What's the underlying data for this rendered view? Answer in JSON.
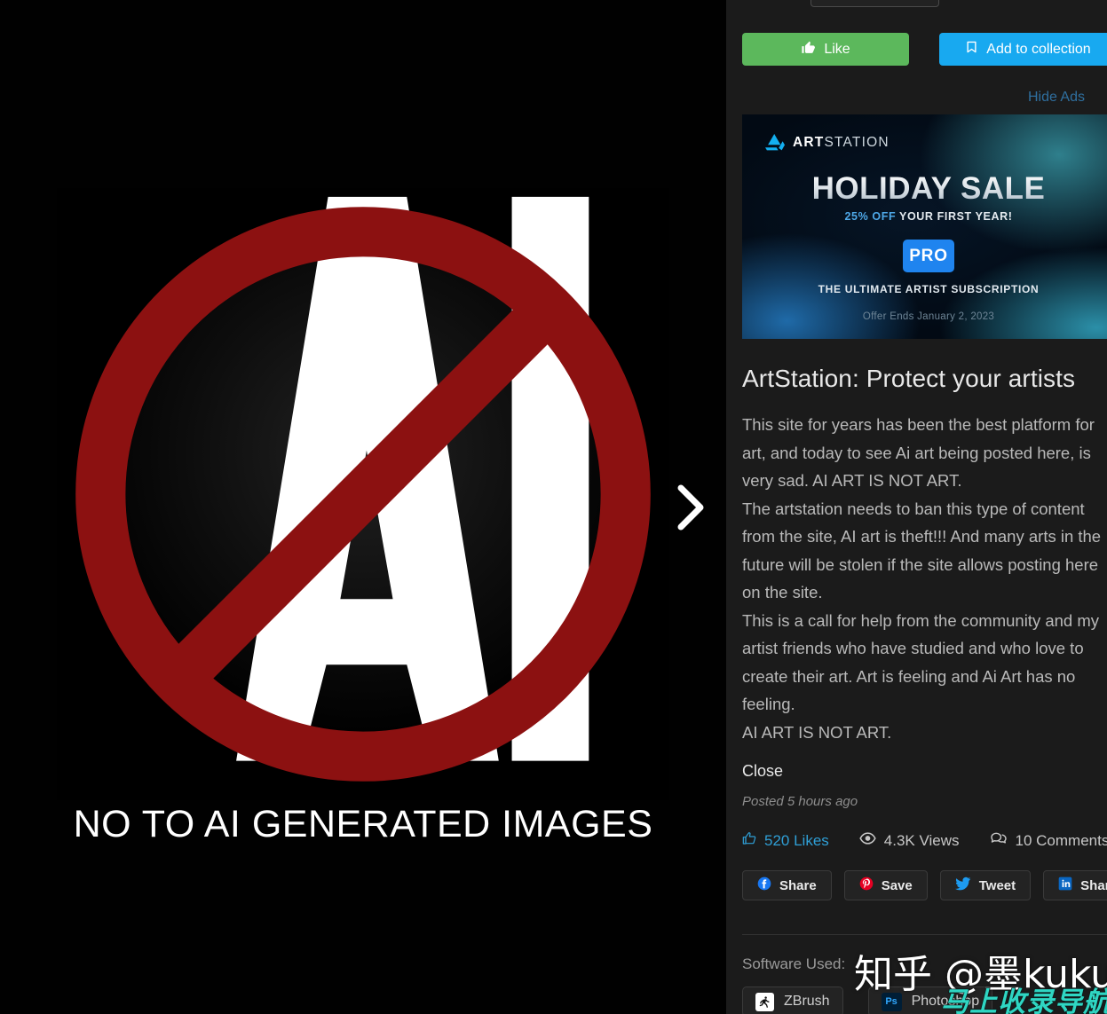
{
  "viewer": {
    "artwork_caption": "NO TO AI GENERATED IMAGES",
    "artwork_letters": "AI",
    "next_arrow_icon": "chevron-right-icon",
    "sign_color": "#8c1111",
    "background_color": "#000000"
  },
  "sidebar": {
    "actions": {
      "like_label": "Like",
      "like_icon": "thumbs-up-icon",
      "like_color": "#5cb85c",
      "collect_label": "Add to collection",
      "collect_icon": "bookmark-icon",
      "collect_color": "#18a9f0"
    },
    "hide_ads_label": "Hide Ads",
    "hide_ads_color": "#2f6f9f",
    "ad": {
      "brand_bold": "ART",
      "brand_light": "STATION",
      "brand_icon": "artstation-logo-icon",
      "headline": "HOLIDAY SALE",
      "discount": "25% OFF",
      "subheadline_rest": "YOUR FIRST YEAR!",
      "badge": "PRO",
      "tagline": "THE ULTIMATE ARTIST SUBSCRIPTION",
      "offer_ends": "Offer Ends January 2, 2023",
      "badge_color": "#1f84ef"
    },
    "post": {
      "title": "ArtStation: Protect your artists",
      "paragraphs": [
        "This site for years has been the best platform for art, and today to see Ai art being posted here, is very sad. AI ART IS NOT ART.",
        "The artstation needs to ban this type of content from the site, AI art is theft!!! And many arts in the future will be stolen if the site allows posting here on the site.",
        "This is a call for help from the community and my artist friends who have studied and who love to create their art. Art is feeling and Ai Art has no feeling.",
        "AI ART IS NOT ART."
      ],
      "close_label": "Close",
      "posted_label": "Posted 5 hours ago"
    },
    "stats": [
      {
        "value": "520 Likes",
        "icon": "thumbs-up-icon"
      },
      {
        "value": "4.3K Views",
        "icon": "eye-icon"
      },
      {
        "value": "10 Comments",
        "icon": "comments-icon"
      }
    ],
    "share_buttons": [
      {
        "label": "Share",
        "icon": "facebook-icon",
        "color": "#1877f2"
      },
      {
        "label": "Save",
        "icon": "pinterest-icon",
        "color": "#e60023"
      },
      {
        "label": "Tweet",
        "icon": "twitter-icon",
        "color": "#1d9bf0"
      },
      {
        "label": "Share",
        "icon": "linkedin-icon",
        "color": "#0a66c2"
      }
    ],
    "software": {
      "label": "Software Used:",
      "items": [
        {
          "name": "ZBrush",
          "icon": "zbrush-icon"
        },
        {
          "name": "Photoshop",
          "icon": "photoshop-icon"
        }
      ]
    }
  },
  "watermark": {
    "main": "知乎 @墨kuku",
    "sub": "马上收录导航",
    "sub_color": "#2fd6c3"
  }
}
